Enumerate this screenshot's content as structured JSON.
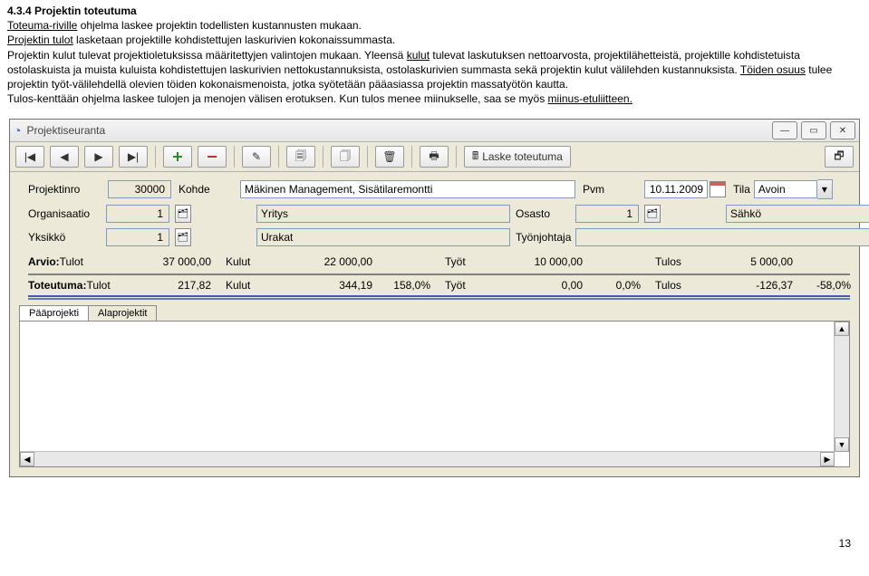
{
  "doc": {
    "heading": "4.3.4 Projektin toteutuma",
    "p1_a": "Toteuma-riville",
    "p1_b": " ohjelma laskee projektin todellisten kustannusten mukaan.",
    "p2_a": "Projektin tulot",
    "p2_b": " lasketaan projektille kohdistettujen laskurivien kokonaissummasta.",
    "p3": "Projektin kulut tulevat projektioletuksissa määritettyjen valintojen mukaan. Yleensä ",
    "p3_u": "kulut",
    "p3_c": " tulevat laskutuksen nettoarvosta, projektilähetteistä, projektille kohdistetuista ostolaskuista ja muista kuluista kohdistettujen laskurivien nettokustannuksista, ostolaskurivien summasta sekä projektin kulut välilehden kustannuksista. ",
    "p3_d": "Töiden osuus",
    "p3_e": " tulee projektin työt-välilehdellä olevien töiden kokonaismenoista, jotka syötetään pääasiassa projektin massatyötön kautta.",
    "p4_a": "Tulos-kenttään ohjelma laskee tulojen ja menojen välisen erotuksen. Kun tulos menee miinukselle, saa se myös ",
    "p4_u": "miinus-etuliitteen.",
    "pagenum": "13"
  },
  "window": {
    "title": "Projektiseuranta",
    "toolbar": {
      "laske": "Laske toteutuma"
    }
  },
  "form": {
    "labels": {
      "projektinro": "Projektinro",
      "kohde": "Kohde",
      "pvm": "Pvm",
      "tila": "Tila",
      "organisaatio": "Organisaatio",
      "osasto": "Osasto",
      "yksikko": "Yksikkö",
      "tyonjohtaja": "Työnjohtaja"
    },
    "values": {
      "projektinro": "30000",
      "kohde": "Mäkinen Management, Sisätilaremontti",
      "pvm": "10.11.2009",
      "tila": "Avoin",
      "organisaatio_id": "1",
      "organisaatio_name": "Yritys",
      "osasto_id": "1",
      "osasto_name": "Sähkö",
      "yksikko_id": "1",
      "yksikko_name": "Urakat",
      "tyonjohtaja": ""
    }
  },
  "calc": {
    "arvio_label": "Arvio:",
    "toteutuma_label": "Toteutuma:",
    "col": {
      "tulot": "Tulot",
      "kulut": "Kulut",
      "tyot": "Työt",
      "tulos": "Tulos"
    },
    "arvio": {
      "tulot": "37 000,00",
      "kulut": "22 000,00",
      "tyot": "10 000,00",
      "tulos": "5 000,00"
    },
    "toteutuma": {
      "tulot": "217,82",
      "kulut": "344,19",
      "kulut_pct": "158,0%",
      "tyot": "0,00",
      "tyot_pct": "0,0%",
      "tulos": "-126,37",
      "tulos_pct": "-58,0%"
    }
  },
  "tabs": {
    "main": "Pääprojekti",
    "sub": "Alaprojektit"
  }
}
